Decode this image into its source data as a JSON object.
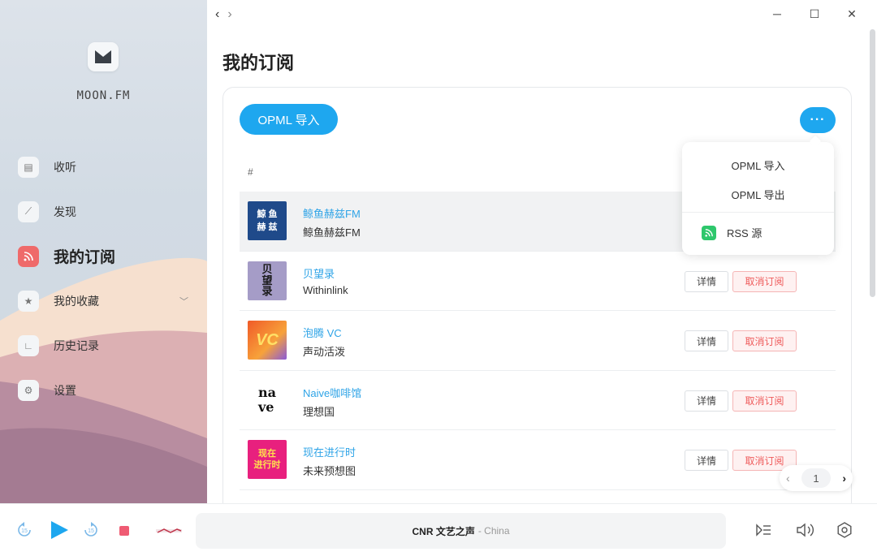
{
  "sidebar": {
    "brand": "MOON.FM",
    "items": [
      {
        "label": "收听"
      },
      {
        "label": "发现"
      },
      {
        "label": "我的订阅"
      },
      {
        "label": "我的收藏"
      },
      {
        "label": "历史记录"
      },
      {
        "label": "设置"
      }
    ]
  },
  "header": {
    "title": "我的订阅"
  },
  "toolbar": {
    "import_label": "OPML 导入",
    "more_label": "···"
  },
  "table": {
    "index_header": "#"
  },
  "menu": {
    "import": "OPML 导入",
    "export": "OPML 导出",
    "rss": "RSS 源"
  },
  "podcasts": [
    {
      "title": "鲸鱼赫兹FM",
      "author": "鲸鱼赫兹FM",
      "cover_text": "鯨 鱼\n赫 兹",
      "cover_bg": "#1f4a8a"
    },
    {
      "title": "贝望录",
      "author": "Withinlink",
      "cover_text": "贝\n望\n录",
      "cover_bg": "#a59cc7"
    },
    {
      "title": "泡腾 VC",
      "author": "声动活泼",
      "cover_text": "VC",
      "cover_bg": "#f07a2a"
    },
    {
      "title": "Naive咖啡馆",
      "author": "理想国",
      "cover_text": "na\nve",
      "cover_bg": "#ffffff"
    },
    {
      "title": "现在进行时",
      "author": "未来预想图",
      "cover_text": "现在\n进行时",
      "cover_bg": "#e8207e"
    }
  ],
  "row_actions": {
    "detail": "详情",
    "unsubscribe": "取消订阅"
  },
  "pagination": {
    "current": "1"
  },
  "player": {
    "station": "CNR 文艺之声",
    "country": "- China"
  },
  "colors": {
    "accent": "#1ea7ef",
    "active_nav": "#ef6a6a",
    "danger": "#ef5b5b",
    "rss": "#2ec76c"
  }
}
